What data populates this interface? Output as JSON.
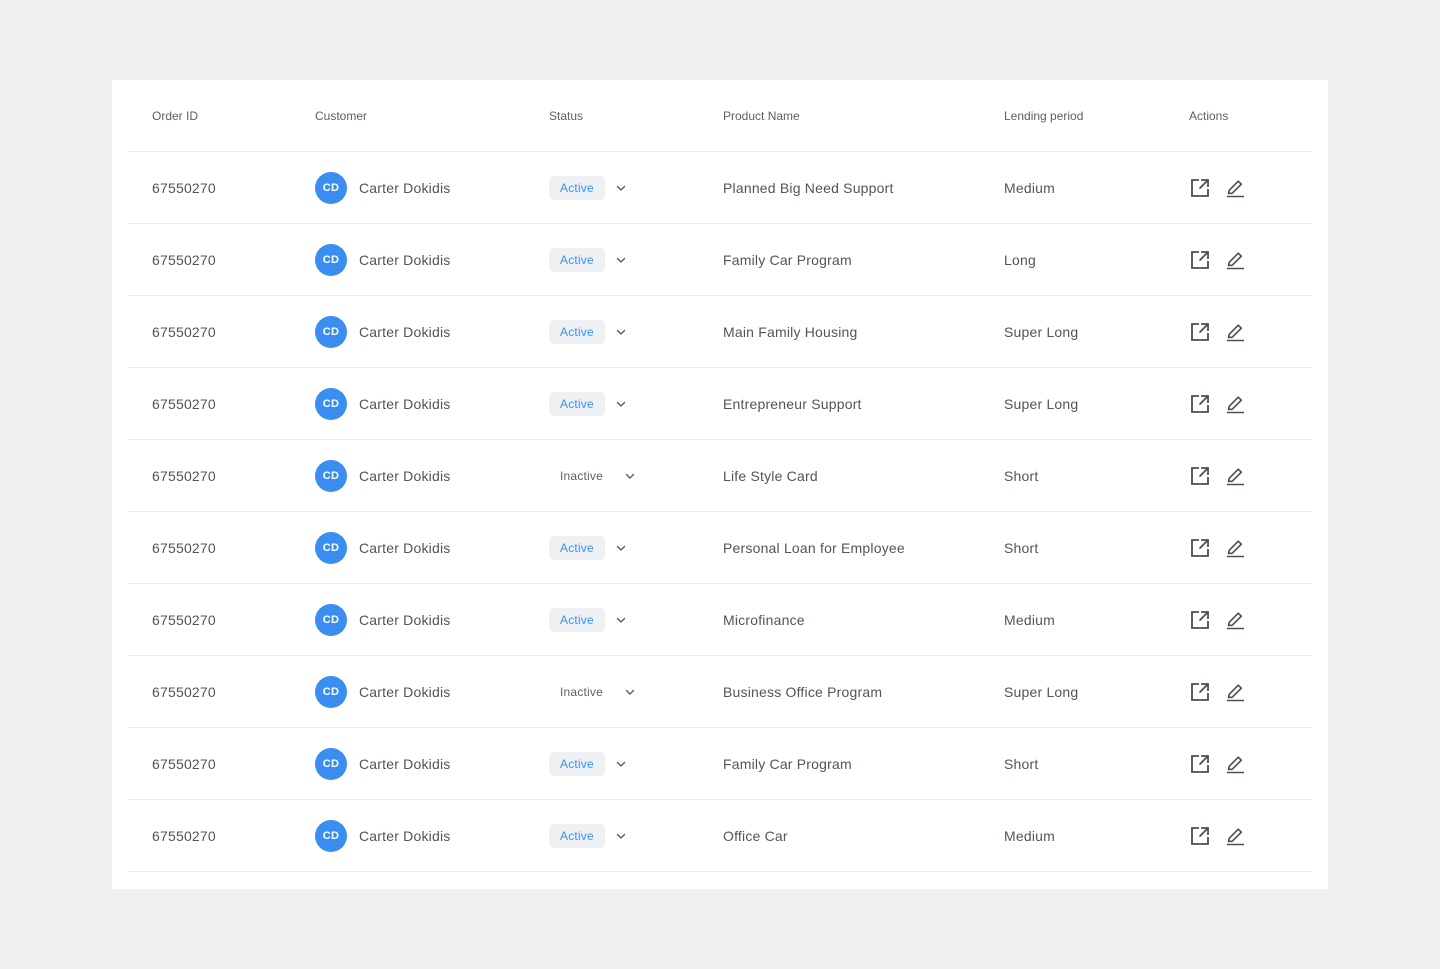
{
  "headers": {
    "order_id": "Order ID",
    "customer": "Customer",
    "status": "Status",
    "product_name": "Product Name",
    "lending_period": "Lending period",
    "actions": "Actions"
  },
  "colors": {
    "accent": "#3b8ef0",
    "background": "#efefef",
    "card": "#ffffff"
  },
  "rows": [
    {
      "order_id": "67550270",
      "initials": "CD",
      "customer": "Carter Dokidis",
      "status": "Active",
      "product": "Planned Big Need Support",
      "period": "Medium"
    },
    {
      "order_id": "67550270",
      "initials": "CD",
      "customer": "Carter Dokidis",
      "status": "Active",
      "product": "Family Car Program",
      "period": "Long"
    },
    {
      "order_id": "67550270",
      "initials": "CD",
      "customer": "Carter Dokidis",
      "status": "Active",
      "product": "Main Family Housing",
      "period": "Super Long"
    },
    {
      "order_id": "67550270",
      "initials": "CD",
      "customer": "Carter Dokidis",
      "status": "Active",
      "product": "Entrepreneur Support",
      "period": "Super Long"
    },
    {
      "order_id": "67550270",
      "initials": "CD",
      "customer": "Carter Dokidis",
      "status": "Inactive",
      "product": "Life Style Card",
      "period": "Short"
    },
    {
      "order_id": "67550270",
      "initials": "CD",
      "customer": "Carter Dokidis",
      "status": "Active",
      "product": "Personal Loan for Employee",
      "period": "Short"
    },
    {
      "order_id": "67550270",
      "initials": "CD",
      "customer": "Carter Dokidis",
      "status": "Active",
      "product": "Microfinance",
      "period": "Medium"
    },
    {
      "order_id": "67550270",
      "initials": "CD",
      "customer": "Carter Dokidis",
      "status": "Inactive",
      "product": "Business Office Program",
      "period": "Super Long"
    },
    {
      "order_id": "67550270",
      "initials": "CD",
      "customer": "Carter Dokidis",
      "status": "Active",
      "product": "Family Car Program",
      "period": "Short"
    },
    {
      "order_id": "67550270",
      "initials": "CD",
      "customer": "Carter Dokidis",
      "status": "Active",
      "product": "Office Car",
      "period": "Medium"
    }
  ],
  "icons": {
    "status_toggle": "chevron-down-icon",
    "open": "external-link-icon",
    "edit": "pencil-icon"
  }
}
